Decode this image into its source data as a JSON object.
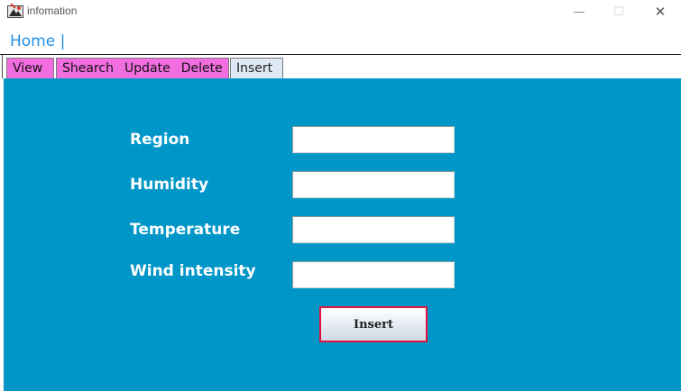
{
  "window": {
    "title": "infomation",
    "icons": {
      "app": "app-icon",
      "minimize": "minimize-icon",
      "maximize": "maximize-icon",
      "close": "close-icon"
    },
    "controls": {
      "minimize": "—",
      "maximize": "☐",
      "close": "✕"
    }
  },
  "menu": {
    "home_label": "Home |"
  },
  "tabs": {
    "view": "View",
    "group": [
      "Shearch",
      "Update",
      "Delete"
    ],
    "insert": "Insert",
    "active": "Insert",
    "colors": {
      "pink": "#f26ee0",
      "active": "#dfe9f5"
    }
  },
  "form": {
    "background": "#0096c7",
    "fields": [
      {
        "label": "Region",
        "value": ""
      },
      {
        "label": "Humidity",
        "value": ""
      },
      {
        "label": "Temperature",
        "value": ""
      },
      {
        "label": "Wind intensity",
        "value": ""
      }
    ],
    "submit_label": "Insert",
    "submit_border": "#e2143c"
  }
}
